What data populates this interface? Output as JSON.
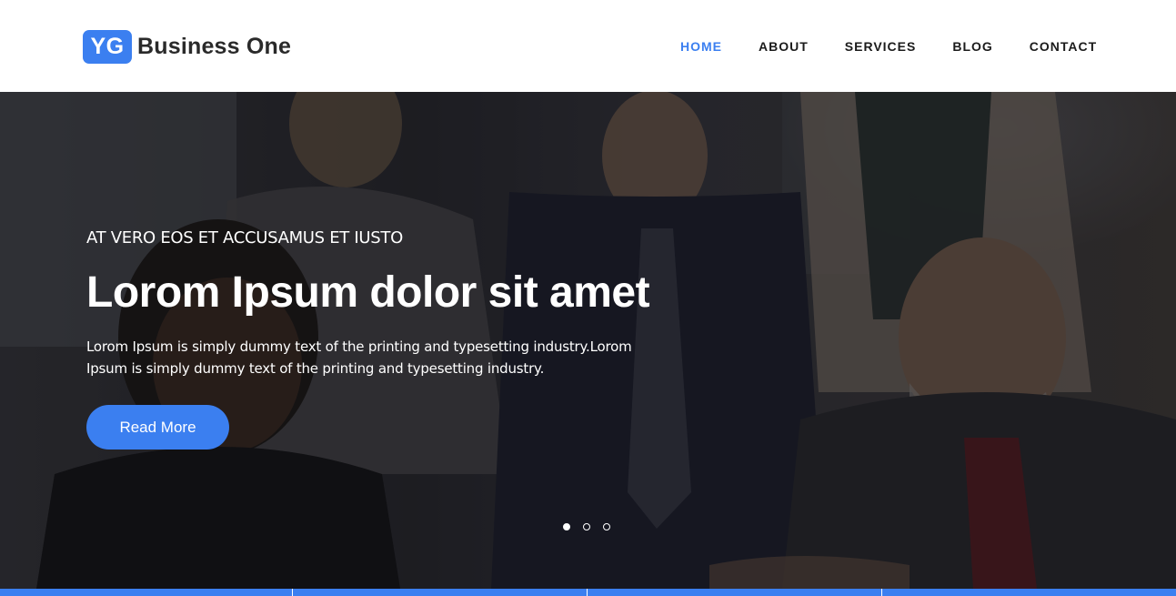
{
  "brand": {
    "badge": "YG",
    "name": "Business One",
    "accent_color": "#3b7ff0"
  },
  "nav": {
    "items": [
      {
        "label": "HOME",
        "active": true
      },
      {
        "label": "ABOUT",
        "active": false
      },
      {
        "label": "SERVICES",
        "active": false
      },
      {
        "label": "BLOG",
        "active": false
      },
      {
        "label": "CONTACT",
        "active": false
      }
    ]
  },
  "hero": {
    "eyebrow": "AT VERO EOS ET ACCUSAMUS ET IUSTO",
    "title": "Lorom Ipsum dolor sit amet",
    "description": "Lorom Ipsum is simply dummy text of the printing and typesetting industry.Lorom Ipsum is simply dummy text of the printing and typesetting industry.",
    "cta_label": "Read More",
    "background": "business-meeting-photo",
    "slides": {
      "total": 3,
      "active": 1
    }
  }
}
